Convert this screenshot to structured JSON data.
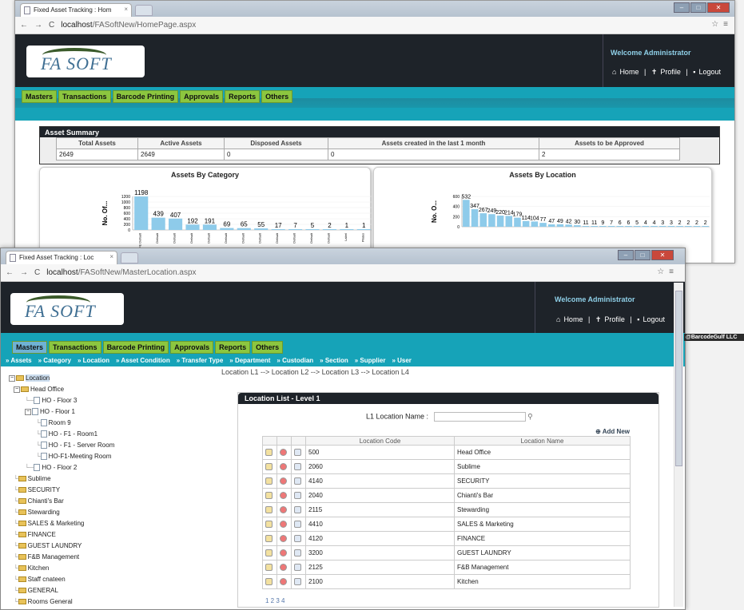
{
  "window1": {
    "tab_title": "Fixed Asset Tracking : Hom",
    "url_host": "localhost",
    "url_path": "/FASoftNew/HomePage.aspx",
    "logo": "FA SOFT",
    "welcome": "Welcome Administrator",
    "links": {
      "home": "Home",
      "profile": "Profile",
      "logout": "Logout",
      "sep": "|"
    },
    "menu": [
      "Masters",
      "Transactions",
      "Barcode Printing",
      "Approvals",
      "Reports",
      "Others"
    ],
    "summary": {
      "title": "Asset Summary",
      "headers": [
        "Total Assets",
        "Active Assets",
        "Disposed Assets",
        "Assets created in the last 1 month",
        "Assets to be Approved"
      ],
      "values": [
        "2649",
        "2649",
        "0",
        "0",
        "2"
      ]
    }
  },
  "chart_data": [
    {
      "type": "bar",
      "title": "Assets By Category",
      "ylabel": "No. Of...",
      "ylim": [
        0,
        1200
      ],
      "yticks": [
        "1200",
        "1000",
        "800",
        "600",
        "400",
        "200",
        "0"
      ],
      "categories": [
        "FFE Default",
        "Default",
        "Default",
        "Default",
        "Default",
        "Default",
        "Default",
        "Default",
        "Default",
        "Default",
        "Default",
        "Default",
        "Label",
        "Plates"
      ],
      "values": [
        1198,
        439,
        407,
        192,
        191,
        69,
        65,
        55,
        17,
        7,
        5,
        2,
        1,
        1
      ],
      "color": "#8ecbea"
    },
    {
      "type": "bar",
      "title": "Assets By Location",
      "ylabel": "No. O...",
      "ylim": [
        0,
        600
      ],
      "yticks": [
        "600",
        "400",
        "200",
        "0"
      ],
      "values": [
        532,
        347,
        267,
        249,
        220,
        214,
        179,
        114,
        104,
        77,
        47,
        49,
        42,
        30,
        11,
        11,
        9,
        7,
        6,
        6,
        5,
        4,
        4,
        3,
        3,
        2,
        2,
        2,
        2
      ],
      "labels": [
        "532",
        "347",
        "267",
        "249",
        "220",
        "214",
        "179",
        "114",
        "104",
        "77",
        "47",
        "49",
        "42",
        "30",
        "11",
        "11",
        "9",
        "7",
        "6",
        "6",
        "5",
        "4",
        "4",
        "3",
        "3",
        "2",
        "2",
        "2",
        "2"
      ],
      "color": "#8ecbea"
    }
  ],
  "window2": {
    "tab_title": "Fixed Asset Tracking : Loc",
    "url_host": "localhost",
    "url_path": "/FASoftNew/MasterLocation.aspx",
    "logo": "FA SOFT",
    "welcome": "Welcome Administrator",
    "links": {
      "home": "Home",
      "profile": "Profile",
      "logout": "Logout",
      "sep": "|"
    },
    "menu": [
      "Masters",
      "Transactions",
      "Barcode Printing",
      "Approvals",
      "Reports",
      "Others"
    ],
    "submenu": [
      "» Assets",
      "» Category",
      "» Location",
      "» Asset Condition",
      "» Transfer Type",
      "» Department",
      "» Custodian",
      "» Section",
      "» Supplier",
      "» User"
    ],
    "breadcrumb": "Location L1  --> Location L2  --> Location L3  --> Location L4",
    "copyright": "@BarcodeGulf LLC",
    "tree": {
      "root": "Location",
      "head_office": "Head Office",
      "ho_floor3": "HO - Floor 3",
      "ho_floor1": "HO - Floor 1",
      "room9": "Room 9",
      "room1": "HO - F1 - Room1",
      "server": "HO - F1 - Server Room",
      "meeting": "HO-F1-Meeting Room",
      "ho_floor2": "HO - Floor 2",
      "others": [
        "Sublime",
        "SECURITY",
        "Chianti's Bar",
        "Stewarding",
        "SALES & Marketing",
        "FINANCE",
        "GUEST LAUNDRY",
        "F&B Management",
        "Kitchen",
        "Staff cnateen",
        "GENERAL",
        "Rooms General"
      ]
    },
    "list": {
      "title": "Location List - Level 1",
      "search_label": "L1 Location Name :",
      "add_new": "Add New",
      "col_code": "Location Code",
      "col_name": "Location Name",
      "rows": [
        {
          "code": "500",
          "name": "Head Office"
        },
        {
          "code": "2060",
          "name": "Sublime"
        },
        {
          "code": "4140",
          "name": "SECURITY"
        },
        {
          "code": "2040",
          "name": "Chianti's Bar"
        },
        {
          "code": "2115",
          "name": "Stewarding"
        },
        {
          "code": "4410",
          "name": "SALES & Marketing"
        },
        {
          "code": "4120",
          "name": "FINANCE"
        },
        {
          "code": "3200",
          "name": "GUEST LAUNDRY"
        },
        {
          "code": "2125",
          "name": "F&B Management"
        },
        {
          "code": "2100",
          "name": "Kitchen"
        }
      ],
      "pages": "1 2 3 4"
    }
  }
}
